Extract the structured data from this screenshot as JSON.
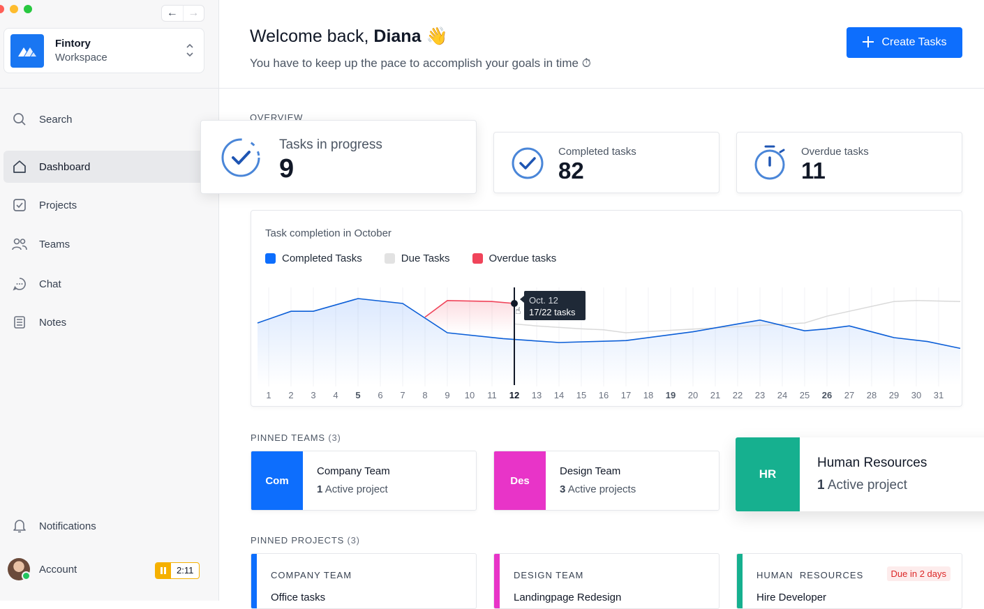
{
  "window": {
    "back_arrow": "←",
    "forward_arrow": "→"
  },
  "workspace": {
    "name": "Fintory",
    "subtitle": "Workspace"
  },
  "sidebar": {
    "items": [
      {
        "label": "Search",
        "icon": "search-icon"
      },
      {
        "label": "Dashboard",
        "icon": "home-icon",
        "active": true
      },
      {
        "label": "Projects",
        "icon": "checkbox-icon"
      },
      {
        "label": "Teams",
        "icon": "users-icon"
      },
      {
        "label": "Chat",
        "icon": "chat-icon"
      },
      {
        "label": "Notes",
        "icon": "notes-icon"
      }
    ],
    "notifications_label": "Notifications",
    "account_label": "Account",
    "timer": "2:11"
  },
  "header": {
    "welcome_prefix": "Welcome back,",
    "user_name": "Diana",
    "wave_emoji": "👋",
    "subtitle": "You have to keep up the pace to accomplish your goals in time ⏱",
    "create_button": "Create Tasks"
  },
  "overview": {
    "label": "OVERVIEW",
    "stats": [
      {
        "label": "Tasks in progress",
        "value": "9"
      },
      {
        "label": "Completed tasks",
        "value": "82"
      },
      {
        "label": "Overdue tasks",
        "value": "11"
      }
    ]
  },
  "chart_data": {
    "type": "line",
    "title": "Task completion in October",
    "legend": [
      "Completed Tasks",
      "Due Tasks",
      "Overdue tasks"
    ],
    "colors": {
      "completed": "#0b5ed7",
      "due": "#d9d9d9",
      "overdue": "#f0445a"
    },
    "x": [
      1,
      2,
      3,
      4,
      5,
      6,
      7,
      8,
      9,
      10,
      11,
      12,
      13,
      14,
      15,
      16,
      17,
      18,
      19,
      20,
      21,
      22,
      23,
      24,
      25,
      26,
      27,
      28,
      29,
      30,
      31
    ],
    "bold_ticks": [
      5,
      12,
      19,
      26
    ],
    "series": [
      {
        "name": "Completed Tasks",
        "values": [
          60,
          72,
          72,
          85,
          80,
          50,
          44,
          40,
          42,
          51,
          57,
          63,
          52,
          54,
          57,
          45,
          41,
          34
        ]
      },
      {
        "name": "Overdue tasks",
        "values": [
          66,
          83,
          82,
          80
        ]
      },
      {
        "name": "Due Tasks",
        "values": [
          59,
          57,
          54,
          53,
          50,
          60,
          67,
          82,
          83,
          82
        ]
      }
    ],
    "tooltip": {
      "date": "Oct. 12",
      "value": "17/22 tasks",
      "day": 12
    }
  },
  "pinned_teams": {
    "label": "PINNED TEAMS",
    "count": "(3)",
    "items": [
      {
        "abbr": "Com",
        "name": "Company Team",
        "count": "1",
        "suffix": "Active project",
        "color": "#0d6efd"
      },
      {
        "abbr": "Des",
        "name": "Design Team",
        "count": "3",
        "suffix": "Active projects",
        "color": "#e834c8"
      },
      {
        "abbr": "HR",
        "name": "Human Resources",
        "count": "1",
        "suffix": "Active project",
        "color": "#16b08f"
      }
    ]
  },
  "pinned_projects": {
    "label": "PINNED PROJECTS",
    "count": "(3)",
    "items": [
      {
        "team": "COMPANY TEAM",
        "name": "Office tasks",
        "color": "#0d6efd"
      },
      {
        "team": "DESIGN TEAM",
        "name": "Landingpage Redesign",
        "color": "#e834c8"
      },
      {
        "team": "HUMAN  RESOURCES",
        "name": "Hire Developer",
        "color": "#16b08f",
        "badge": "Due in 2 days"
      }
    ]
  }
}
